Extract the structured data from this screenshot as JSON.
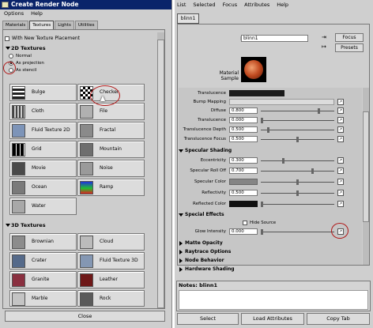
{
  "left": {
    "title": "Create Render Node",
    "menu": [
      "Options",
      "Help"
    ],
    "tabs": [
      "Materials",
      "Textures",
      "Lights",
      "Utilities"
    ],
    "active_tab": "Textures",
    "with_new_placement": "With New Texture Placement",
    "section_2d": "2D Textures",
    "radio": [
      {
        "label": "Normal",
        "selected": false
      },
      {
        "label": "As projection",
        "selected": true
      },
      {
        "label": "As stencil",
        "selected": false
      }
    ],
    "textures_2d": [
      "Bulge",
      "Checker",
      "Cloth",
      "File",
      "Fluid Texture 2D",
      "Fractal",
      "Grid",
      "Mountain",
      "Movie",
      "Noise",
      "Ocean",
      "Ramp",
      "Water"
    ],
    "section_3d": "3D Textures",
    "textures_3d": [
      "Brownian",
      "Cloud",
      "Crater",
      "Fluid Texture 3D",
      "Granite",
      "Leather",
      "Marble",
      "Rock"
    ],
    "close_label": "Close"
  },
  "right": {
    "menu": [
      "List",
      "Selected",
      "Focus",
      "Attributes",
      "Help"
    ],
    "node_tab": "blinn1",
    "name_label": "blinn:",
    "name_value": "blinn1",
    "focus_label": "Focus",
    "preset_label": "Presets",
    "material_sample_label": "Material Sample",
    "top_rows": [
      {
        "label": "Translucence",
        "value": ""
      },
      {
        "label": "Bump Mapping",
        "value": ""
      },
      {
        "label": "Diffuse",
        "value": "0.800",
        "knob": 0.8
      },
      {
        "label": "Translucence",
        "value": "0.000",
        "knob": 0.0
      },
      {
        "label": "Translucence Depth",
        "value": "0.500",
        "knob": 0.1
      },
      {
        "label": "Translucence Focus",
        "value": "0.500",
        "knob": 0.5
      }
    ],
    "specular_section": "Specular Shading",
    "specular_rows": [
      {
        "label": "Eccentricity",
        "value": "0.300",
        "knob": 0.3
      },
      {
        "label": "Specular Roll Off",
        "value": "0.700",
        "knob": 0.7
      },
      {
        "label": "Specular Color",
        "value": ""
      },
      {
        "label": "Reflectivity",
        "value": "0.500",
        "knob": 0.5
      },
      {
        "label": "Reflected Color",
        "value": ""
      }
    ],
    "special_section": "Special Effects",
    "hide_source": "Hide Source",
    "glow_label": "Glow Intensity",
    "glow_value": "0.000",
    "collapsed_sections": [
      "Matte Opacity",
      "Raytrace Options",
      "Node Behavior",
      "Hardware Shading"
    ],
    "notes_label": "Notes: blinn1",
    "bottom_buttons": [
      "Select",
      "Load Attributes",
      "Copy Tab"
    ]
  }
}
